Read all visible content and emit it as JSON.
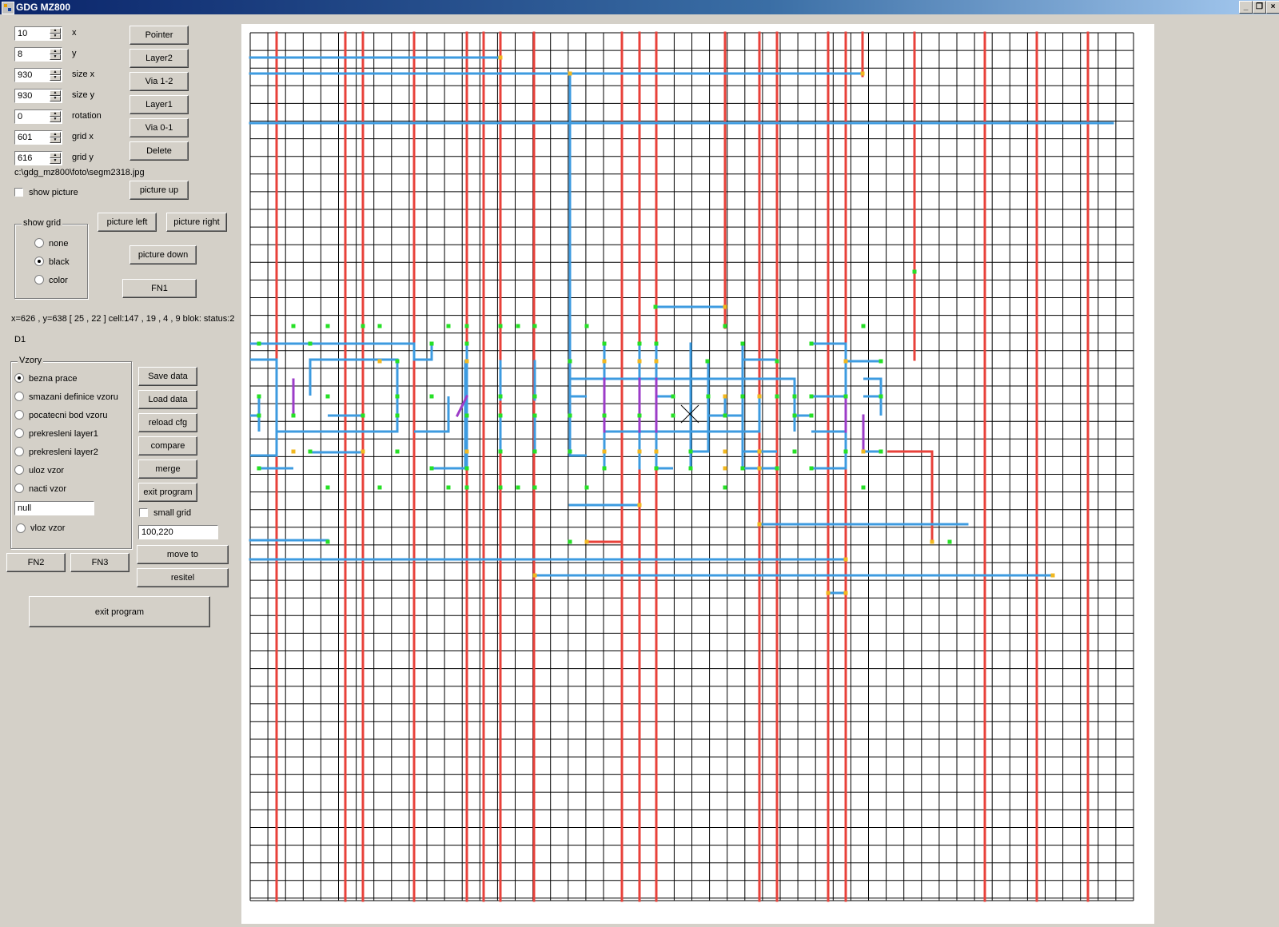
{
  "window": {
    "title": "GDG MZ800"
  },
  "fields": [
    {
      "value": "10",
      "label": "x"
    },
    {
      "value": "8",
      "label": "y"
    },
    {
      "value": "930",
      "label": "size x"
    },
    {
      "value": "930",
      "label": "size y"
    },
    {
      "value": "0",
      "label": "rotation"
    },
    {
      "value": "601",
      "label": "grid x"
    },
    {
      "value": "616",
      "label": "grid y"
    }
  ],
  "tools": {
    "pointer": "Pointer",
    "layer2": "Layer2",
    "via12": "Via 1-2",
    "layer1": "Layer1",
    "via01": "Via 0-1",
    "delete": "Delete"
  },
  "picture": {
    "path": "c:\\gdg_mz800\\foto\\segm2318.jpg",
    "show_label": "show picture",
    "up": "picture up",
    "left": "picture left",
    "right": "picture right",
    "down": "picture down"
  },
  "grid_group": {
    "caption": "show grid",
    "options": [
      "none",
      "black",
      "color"
    ],
    "selected": "black"
  },
  "fn1": "FN1",
  "status": "x=626 ,  y=638 [ 25 , 22 ] cell:147 , 19 , 4 , 9 blok: status:2",
  "d1": "D1",
  "vzory": {
    "caption": "Vzory",
    "options": [
      "bezna prace",
      "smazani definice vzoru",
      "pocatecni bod vzoru",
      "prekresleni layer1",
      "prekresleni layer2",
      "uloz vzor",
      "nacti vzor"
    ],
    "selected": "bezna prace",
    "name_value": "null",
    "insert": "vloz vzor"
  },
  "data_buttons": {
    "save": "Save data",
    "load": "Load data",
    "reload": "reload cfg",
    "compare": "compare",
    "merge": "merge",
    "exit": "exit program"
  },
  "small_grid": "small grid",
  "coords_value": "100,220",
  "move_to": "move to",
  "resitel": "resitel",
  "fn2": "FN2",
  "fn3": "FN3",
  "exit_big": "exit program",
  "colors": {
    "layer1": "#e8413a",
    "layer2": "#3d9be0",
    "via": "#26e026",
    "pad": "#f2b820",
    "jumper": "#9c3cc8"
  }
}
